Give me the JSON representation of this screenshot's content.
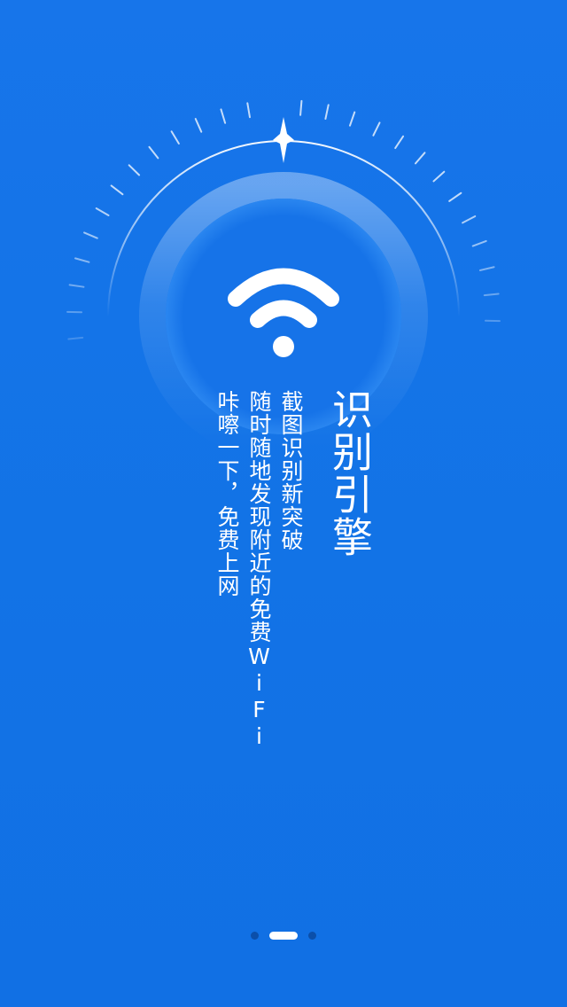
{
  "splash": {
    "title": "识别引擎",
    "lines": [
      "截图识别新突破",
      "随时随地发现附近的免费WiFi",
      "咔嚓一下，免费上网"
    ]
  },
  "icon": "wifi-icon",
  "pager": {
    "total": 3,
    "current": 2
  },
  "colors": {
    "background": "#1273e6",
    "foreground": "#ffffff",
    "inactive_dot": "#0b4faa"
  }
}
